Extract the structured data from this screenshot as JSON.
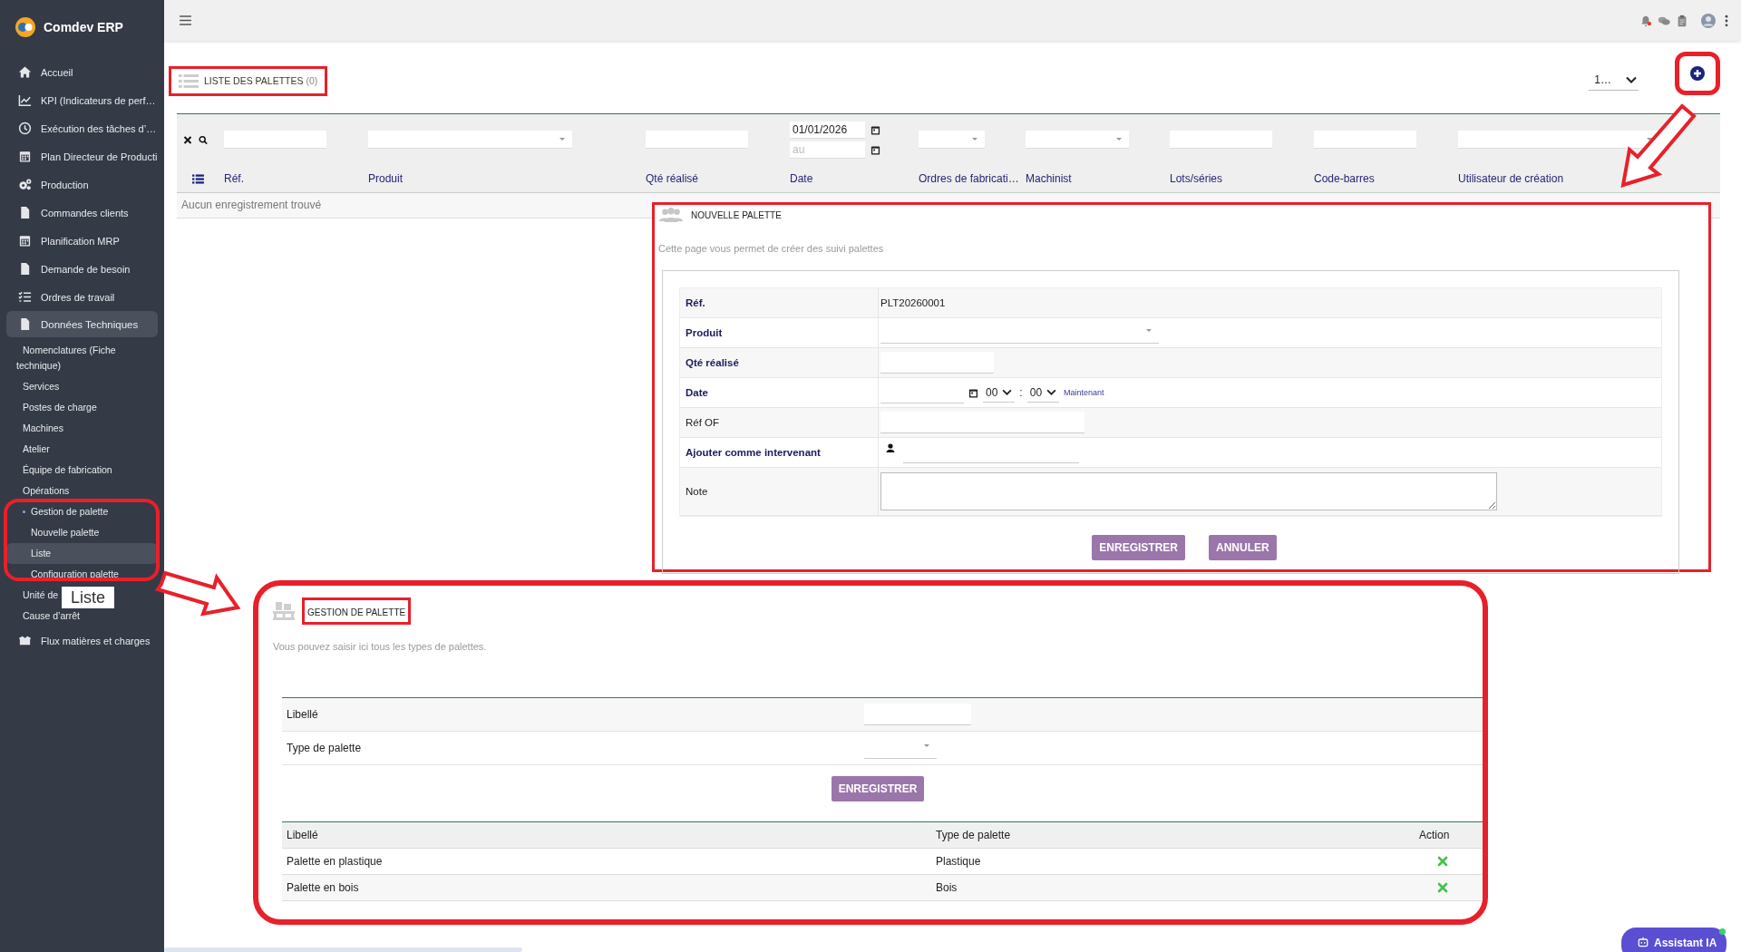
{
  "app": {
    "name": "Comdev ERP"
  },
  "sidebar": {
    "items": [
      {
        "label": "Accueil",
        "selected": false
      },
      {
        "label": "KPI (Indicateurs de perf…",
        "selected": false
      },
      {
        "label": "Exécution des tâches d’…",
        "selected": false
      },
      {
        "label": "Plan Directeur de Producti",
        "selected": false
      },
      {
        "label": "Production",
        "selected": false
      },
      {
        "label": "Commandes clients",
        "selected": false
      },
      {
        "label": "Planification MRP",
        "selected": false
      },
      {
        "label": "Demande de besoin",
        "selected": false
      },
      {
        "label": "Ordres de travail",
        "selected": false
      },
      {
        "label": "Données Techniques",
        "selected": false,
        "expanded": true,
        "children": [
          {
            "label": "Nomenclatures (Fiche technique)",
            "selected": false
          },
          {
            "label": "Services",
            "selected": false
          },
          {
            "label": "Postes de charge",
            "selected": false
          },
          {
            "label": "Machines",
            "selected": false
          },
          {
            "label": "Atelier",
            "selected": false
          },
          {
            "label": "Équipe de fabrication",
            "selected": false
          },
          {
            "label": "Opérations",
            "selected": false
          },
          {
            "label": "Gestion de palette",
            "selected": false,
            "expanded": true,
            "children": [
              {
                "label": "Nouvelle palette",
                "selected": false
              },
              {
                "label": "Liste",
                "selected": true
              },
              {
                "label": "Configuration palette",
                "selected": false
              }
            ]
          },
          {
            "label": "Unité de",
            "selected": false
          },
          {
            "label": "Cause d’arrêt",
            "selected": false
          }
        ]
      },
      {
        "label": "Flux matières et charges",
        "selected": false
      }
    ]
  },
  "tooltip": {
    "text": "Liste"
  },
  "list": {
    "title": "LISTE DES PALETTES",
    "count": "(0)",
    "page_size": "1…",
    "filters": [
      {
        "kind": "input"
      },
      {
        "kind": "select"
      },
      {
        "kind": "input"
      },
      {
        "kind": "daterange",
        "value": "01/01/2026",
        "placeholder": "au"
      },
      {
        "kind": "select"
      },
      {
        "kind": "select"
      },
      {
        "kind": "input"
      },
      {
        "kind": "input"
      },
      {
        "kind": "select"
      }
    ],
    "columns": [
      "Réf.",
      "Produit",
      "Qté réalisé",
      "Date",
      "Ordres de fabricati…",
      "Machinist",
      "Lots/séries",
      "Code-barres",
      "Utilisateur de création"
    ],
    "empty_message": "Aucun enregistrement trouvé"
  },
  "new_palette": {
    "title": "NOUVELLE PALETTE",
    "description": "Cette page vous permet de créer des suivi palettes",
    "fields": [
      {
        "label": "Réf.",
        "required": true,
        "kind": "text",
        "value": "PLT20260001"
      },
      {
        "label": "Produit",
        "required": true,
        "kind": "select"
      },
      {
        "label": "Qté réalisé",
        "required": true,
        "kind": "input"
      },
      {
        "label": "Date",
        "required": true,
        "kind": "datetime",
        "hour": "00",
        "minute": "00",
        "separator": ":",
        "link": "Maintenant"
      },
      {
        "label": "Réf OF",
        "required": false,
        "kind": "input"
      },
      {
        "label": "Ajouter comme intervenant",
        "required": true,
        "kind": "person"
      },
      {
        "label": "Note",
        "required": false,
        "kind": "textarea"
      }
    ],
    "buttons": [
      "ENREGISTRER",
      "ANNULER"
    ]
  },
  "palette_types": {
    "title": "GESTION DE PALETTE",
    "description": "Vous pouvez saisir ici tous les types de palettes.",
    "fields": [
      {
        "label": "Libellé",
        "kind": "input"
      },
      {
        "label": "Type de palette",
        "kind": "select"
      }
    ],
    "button": "ENREGISTRER",
    "columns": [
      "Libellé",
      "Type de palette",
      "Action"
    ],
    "rows": [
      {
        "label": "Palette en plastique",
        "type": "Plastique"
      },
      {
        "label": "Palette en bois",
        "type": "Bois"
      }
    ]
  },
  "assistant": {
    "label": "Assistant IA"
  }
}
